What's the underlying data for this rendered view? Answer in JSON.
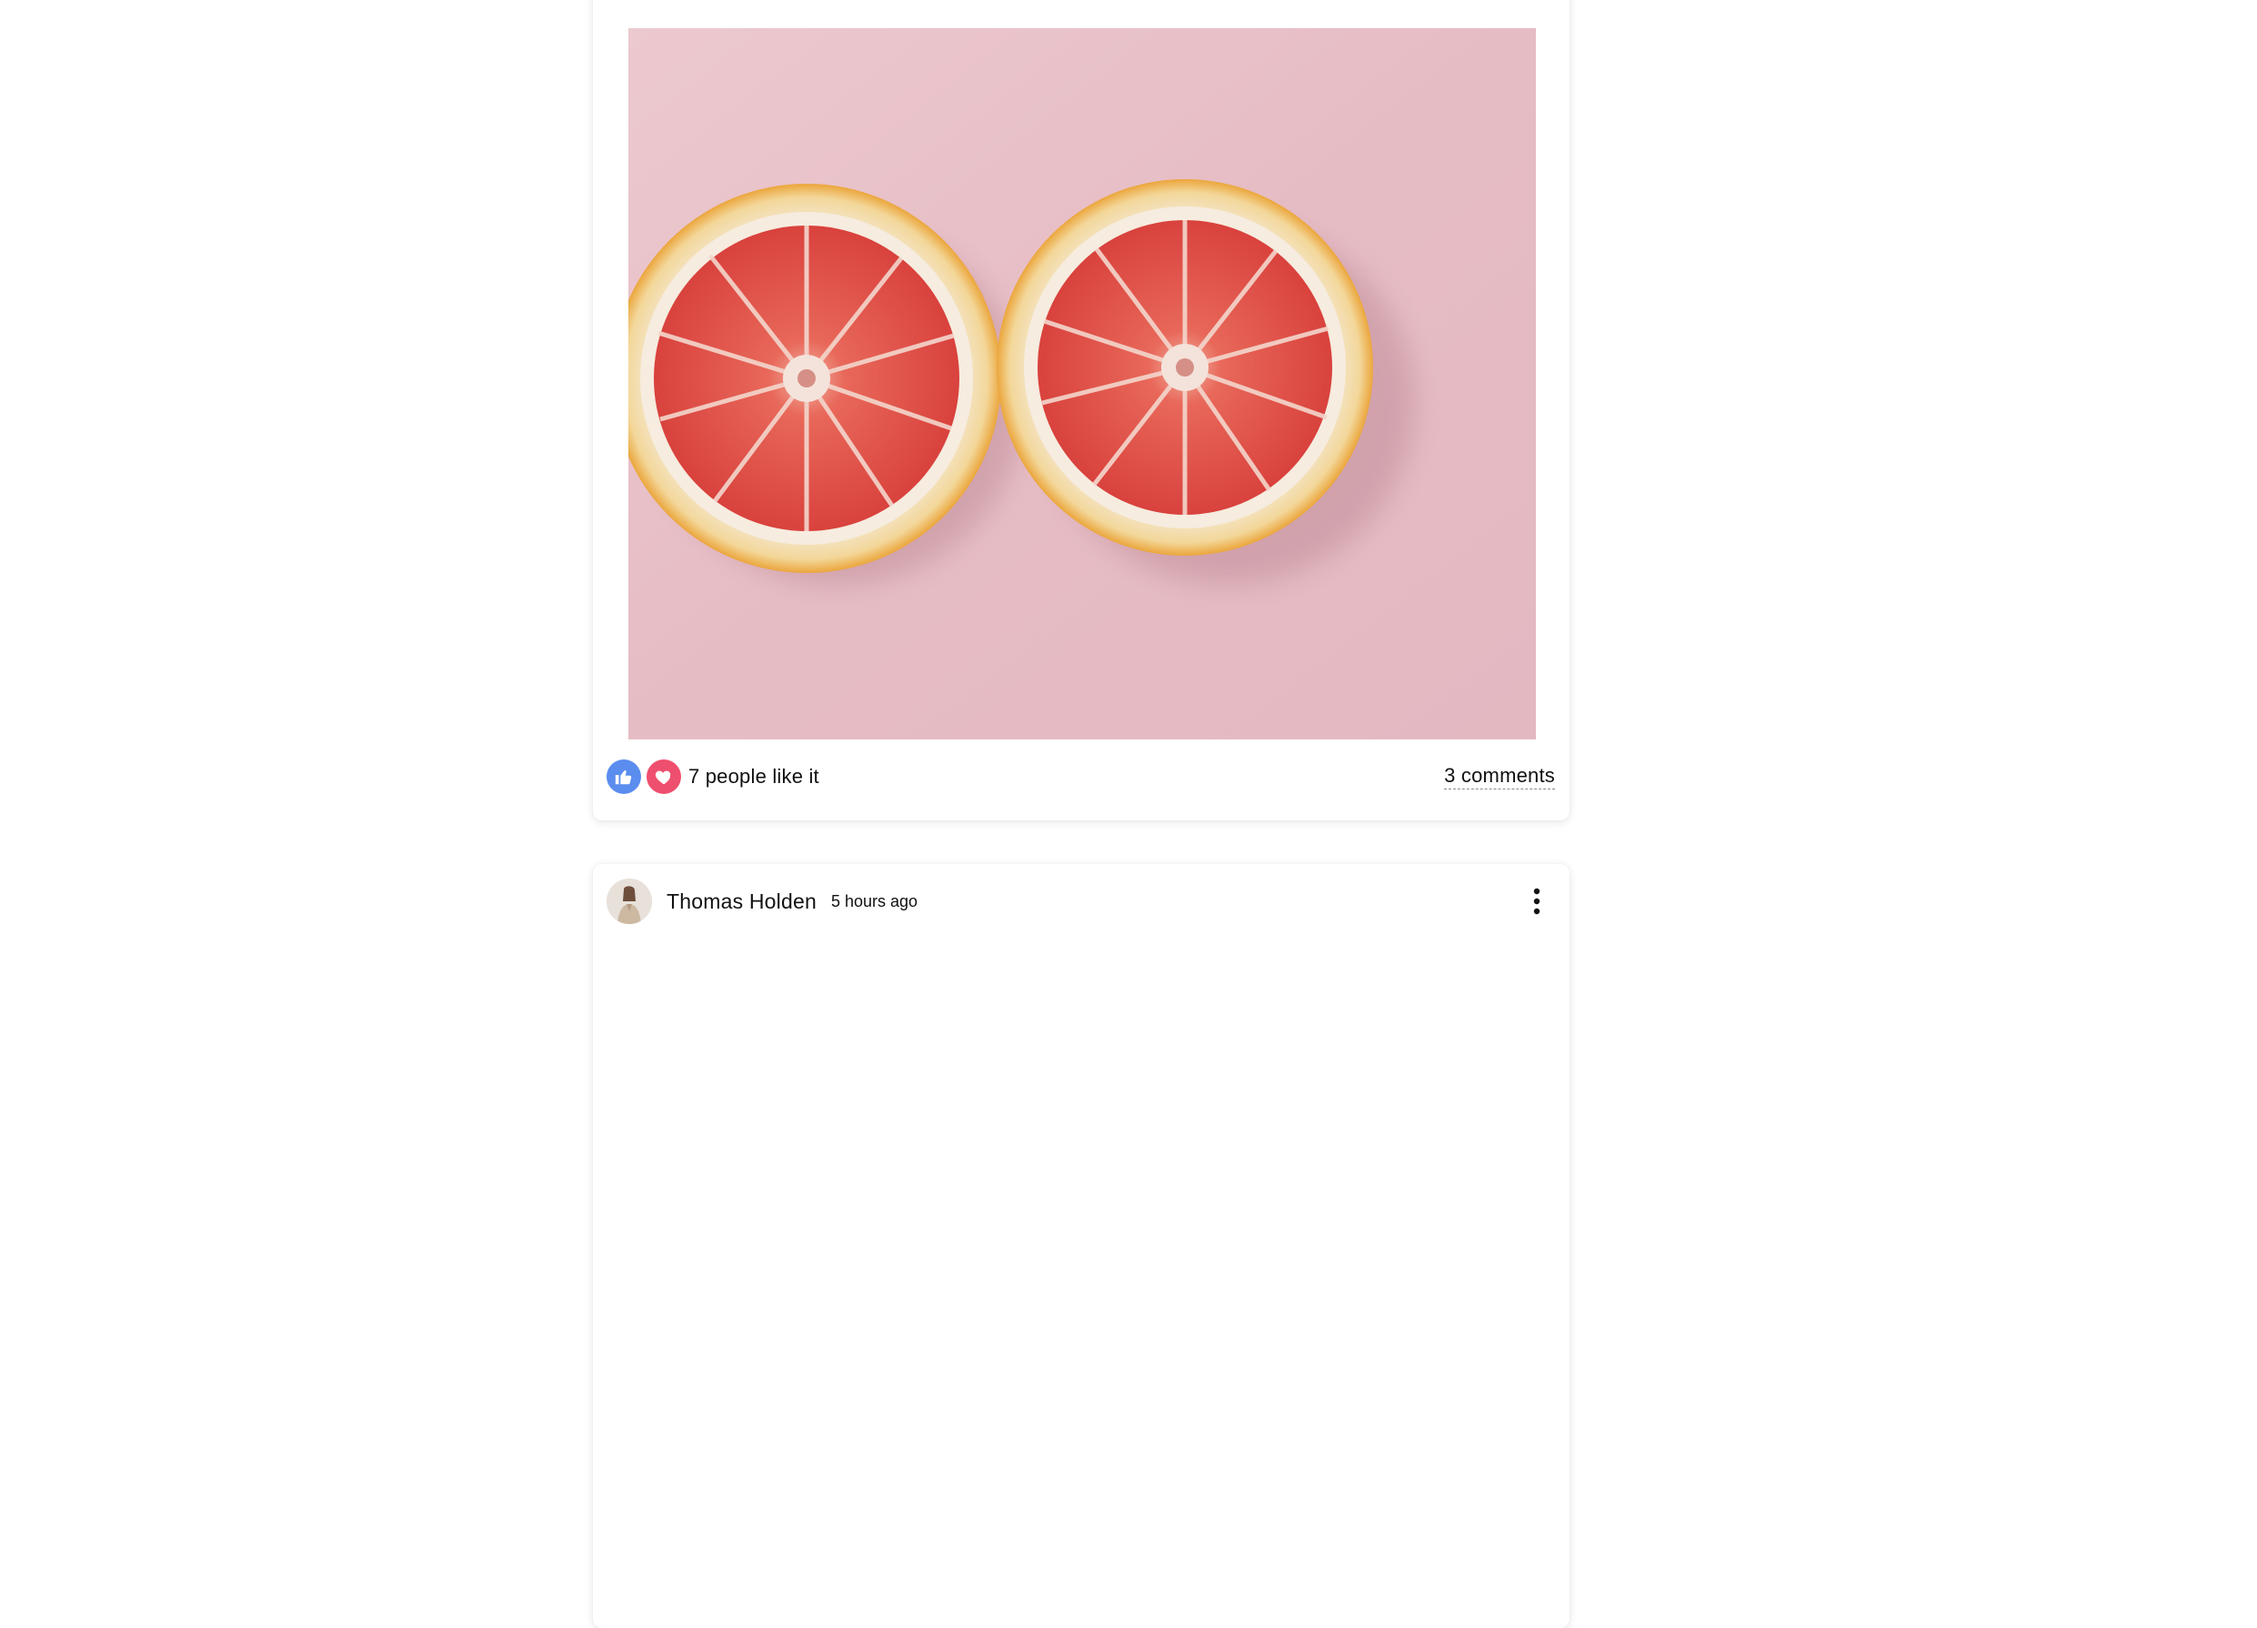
{
  "posts": [
    {
      "image": {
        "subject": "two grapefruit halves on pink background"
      },
      "reactions": {
        "icons": [
          "thumbs-up-icon",
          "heart-icon"
        ],
        "like_color": "#5b8def",
        "heart_color": "#ef4f6e",
        "likes_text": "7 people like it",
        "comments_text": "3 comments"
      }
    },
    {
      "author": "Thomas Holden",
      "time": "5 hours ago",
      "menu_icon": "more-vertical-icon"
    }
  ]
}
